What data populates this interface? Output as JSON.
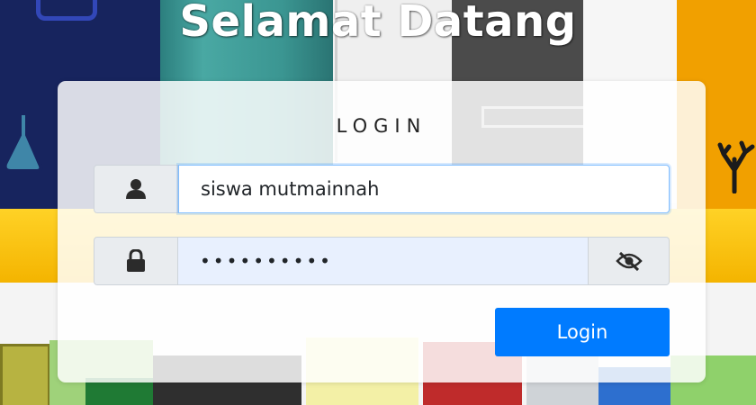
{
  "header": {
    "title": "Selamat Datang"
  },
  "login": {
    "heading": "LOGIN",
    "username": {
      "value": "siswa mutmainnah",
      "icon": "user-icon"
    },
    "password": {
      "value": "••••••••••",
      "icon": "lock-icon",
      "toggle_icon": "eye-slash-icon"
    },
    "submit_label": "Login"
  },
  "colors": {
    "primary": "#007bff",
    "addon_bg": "#e9ecef",
    "autofill_bg": "#e8f0fe"
  }
}
